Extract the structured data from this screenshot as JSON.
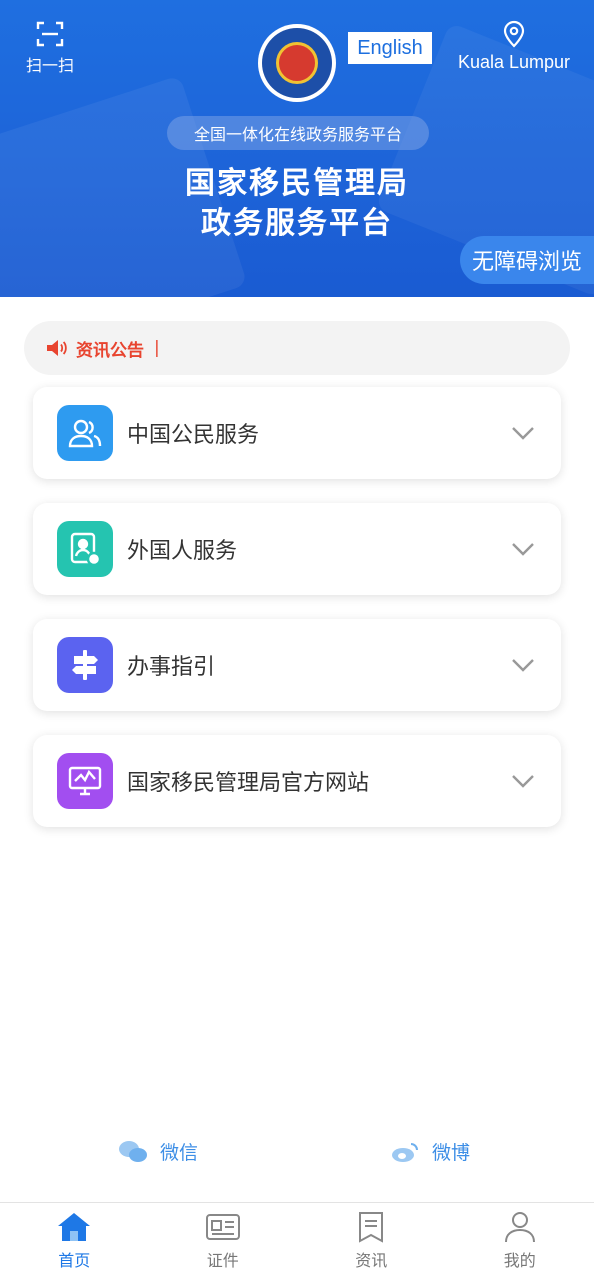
{
  "header": {
    "scan_label": "扫一扫",
    "language_button": "English",
    "location": "Kuala Lumpur",
    "platform_pill": "全国一体化在线政务服务平台",
    "title_line1": "国家移民管理局",
    "title_line2": "政务服务平台",
    "accessibility_button": "无障碍浏览"
  },
  "notice": {
    "label": "资讯公告",
    "separator": "|"
  },
  "services": [
    {
      "label": "中国公民服务",
      "icon": "citizens-icon",
      "color": "#2e9bf0"
    },
    {
      "label": "外国人服务",
      "icon": "foreigner-id-icon",
      "color": "#25c4b0"
    },
    {
      "label": "办事指引",
      "icon": "signpost-icon",
      "color": "#5b63f0"
    },
    {
      "label": "国家移民管理局官方网站",
      "icon": "monitor-chart-icon",
      "color": "#a24ef0"
    }
  ],
  "social": {
    "wechat": "微信",
    "weibo": "微博"
  },
  "nav": [
    {
      "label": "首页",
      "icon": "home-icon",
      "active": true
    },
    {
      "label": "证件",
      "icon": "id-card-icon",
      "active": false
    },
    {
      "label": "资讯",
      "icon": "news-icon",
      "active": false
    },
    {
      "label": "我的",
      "icon": "user-icon",
      "active": false
    }
  ],
  "colors": {
    "brand_blue": "#1f6fe0",
    "notice_red": "#e8442f",
    "nav_active": "#1e78e6"
  }
}
